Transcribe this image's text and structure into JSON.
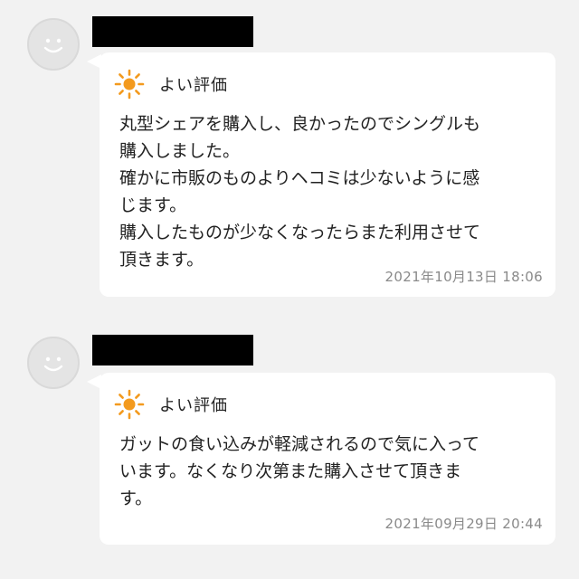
{
  "reviews": [
    {
      "rating_label": "よい評価",
      "comment": "丸型シェアを購入し、良かったのでシングルも\n購入しました。\n確かに市販のものよりヘコミは少ないように感\nじます。\n購入したものが少なくなったらまた利用させて\n頂きます。",
      "timestamp": "2021年10月13日 18:06"
    },
    {
      "rating_label": "よい評価",
      "comment": "ガットの食い込みが軽減されるので気に入って\nいます。なくなり次第また購入させて頂きま\nす。",
      "timestamp": "2021年09月29日 20:44"
    }
  ],
  "icons": {
    "avatar": "smiley-face-icon",
    "rating": "sun-icon"
  },
  "colors": {
    "background": "#f2f2f2",
    "bubble": "#ffffff",
    "sun": "#f39a1e",
    "timestamp": "#8a8a8a",
    "redaction": "#000000"
  }
}
